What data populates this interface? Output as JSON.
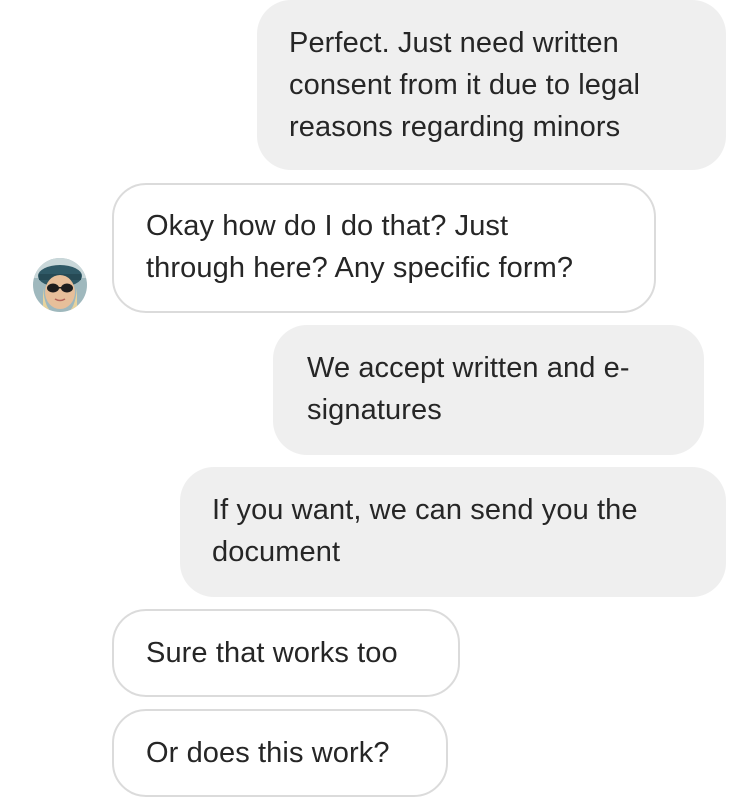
{
  "thread": {
    "messages": [
      {
        "sender": "business",
        "text": "Perfect. Just need written\nconsent from it due to legal\nreasons regarding minors"
      },
      {
        "sender": "user",
        "text": "Okay how do I do that? Just\nthrough here? Any specific form?"
      },
      {
        "sender": "business",
        "text": "We accept written and e-\nsignatures"
      },
      {
        "sender": "business",
        "text": "If you want, we can send you the\ndocument"
      },
      {
        "sender": "user",
        "text": "Sure that works too"
      },
      {
        "sender": "user",
        "text": "Or does this work?"
      }
    ]
  },
  "contact": {
    "avatar_icon": "user-avatar-icon"
  },
  "colors": {
    "outgoing_bubble": "#efefef",
    "incoming_border": "#dbdbdb",
    "text": "#262626",
    "background": "#ffffff"
  }
}
